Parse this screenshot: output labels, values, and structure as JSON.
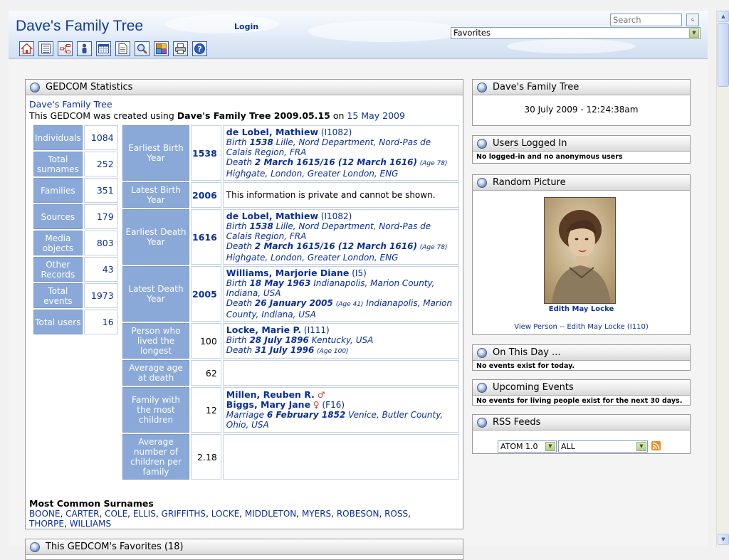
{
  "header": {
    "site_title": "Dave's Family Tree",
    "login": "Login",
    "search_placeholder": "Search",
    "favorites_value": "Favorites",
    "toolbar_icons": [
      "home-icon",
      "list-icon",
      "pedigree-icon",
      "person-icon",
      "calendar-icon",
      "report-icon",
      "search-icon",
      "gallery-icon",
      "print-icon",
      "help-icon"
    ]
  },
  "gedcom": {
    "block_title": "GEDCOM Statistics",
    "name": "Dave's Family Tree",
    "created_prefix": "This GEDCOM was created using",
    "created_software": "Dave's Family Tree 2009.05.15",
    "created_on": "on",
    "created_date": "15 May 2009",
    "counts": [
      {
        "label": "Individuals",
        "value": "1084"
      },
      {
        "label": "Total surnames",
        "value": "252"
      },
      {
        "label": "Families",
        "value": "351"
      },
      {
        "label": "Sources",
        "value": "179"
      },
      {
        "label": "Media objects",
        "value": "803"
      },
      {
        "label": "Other Records",
        "value": "43"
      },
      {
        "label": "Total events",
        "value": "1973"
      },
      {
        "label": "Total users",
        "value": "16"
      }
    ],
    "facts": {
      "earliest_birth": {
        "label": "Earliest Birth Year",
        "year": "1538",
        "name": "de Lobel, Mathiew",
        "id": "(I1082)",
        "birth_pre": "Birth",
        "birth_date": "1538",
        "birth_place": "Lille, Nord Department, Nord-Pas de Calais Region, FRA",
        "death_pre": "Death",
        "death_date": "2 March 1615/16 (12 March 1616)",
        "death_age": "(Age 78)",
        "death_place": "Highgate, London, Greater London, ENG"
      },
      "latest_birth": {
        "label": "Latest Birth Year",
        "year": "2006",
        "text": "This information is private and cannot be shown."
      },
      "earliest_death": {
        "label": "Earliest Death Year",
        "year": "1616",
        "name": "de Lobel, Mathiew",
        "id": "(I1082)",
        "birth_pre": "Birth",
        "birth_date": "1538",
        "birth_place": "Lille, Nord Department, Nord-Pas de Calais Region, FRA",
        "death_pre": "Death",
        "death_date": "2 March 1615/16 (12 March 1616)",
        "death_age": "(Age 78)",
        "death_place": "Highgate, London, Greater London, ENG"
      },
      "latest_death": {
        "label": "Latest Death Year",
        "year": "2005",
        "name": "Williams, Marjorie Diane",
        "id": "(I5)",
        "birth_pre": "Birth",
        "birth_date": "18 May 1963",
        "birth_place": "Indianapolis, Marion County, Indiana, USA",
        "death_pre": "Death",
        "death_date": "26 January 2005",
        "death_age": "(Age 41)",
        "death_place": "Indianapolis, Marion County, Indiana, USA"
      },
      "longest_lived": {
        "label": "Person who lived the longest",
        "value": "100",
        "name": "Locke, Marie P.",
        "id": "(I111)",
        "birth_pre": "Birth",
        "birth_date": "28 July 1896",
        "birth_place": "Kentucky, USA",
        "death_pre": "Death",
        "death_date": "31 July 1996",
        "death_age": "(Age 100)"
      },
      "avg_age": {
        "label": "Average age at death",
        "value": "62"
      },
      "most_children": {
        "label": "Family with the most children",
        "value": "12",
        "husband": "Millen, Reuben R.",
        "husband_sym": "♂",
        "wife": "Biggs, Mary Jane",
        "wife_sym": "♀",
        "fam_id": "(F16)",
        "marriage_pre": "Marriage",
        "marriage_date": "6 February 1852",
        "marriage_place": "Venice, Butler County, Ohio, USA"
      },
      "avg_children": {
        "label": "Average number of children per family",
        "value": "2.18"
      }
    },
    "surnames_title": "Most Common Surnames",
    "surnames": [
      "BOONE",
      "CARTER",
      "COLE",
      "ELLIS",
      "GRIFFITHS",
      "LOCKE",
      "MIDDLETON",
      "MYERS",
      "ROBESON",
      "ROSS",
      "THORPE",
      "WILLIAMS"
    ]
  },
  "favorites_block": {
    "title": "This GEDCOM's Favorites  (18)"
  },
  "right": {
    "tree_title": "Dave's Family Tree",
    "clock": "30 July 2009 - 12:24:38am",
    "users_title": "Users Logged In",
    "users_text": "No logged-in and no anonymous users",
    "picture_title": "Random Picture",
    "picture_name": "Edith May Locke",
    "picture_link": "View Person -- Edith May Locke  (I110)",
    "today_title": "On This Day ...",
    "today_text": "No events exist for today.",
    "upcoming_title": "Upcoming Events",
    "upcoming_text": "No events for living people exist for the next 30 days.",
    "rss_title": "RSS Feeds",
    "rss_format": "ATOM 1.0",
    "rss_filter": "ALL"
  }
}
